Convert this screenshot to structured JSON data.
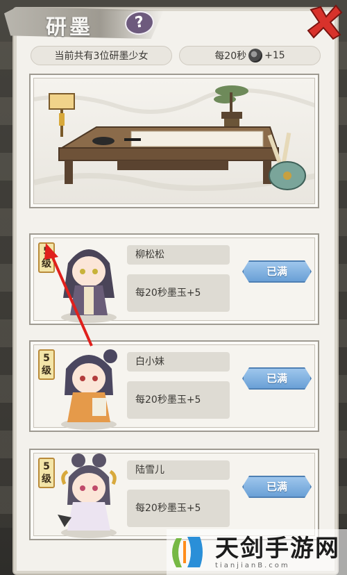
{
  "header": {
    "title": "研墨",
    "help_label": "?"
  },
  "info": {
    "count_text": "当前共有3位研墨少女",
    "rate_prefix": "每20秒",
    "rate_suffix": "+15"
  },
  "characters": [
    {
      "level_num": "5",
      "level_unit": "级",
      "name": "柳松松",
      "rate": "每20秒墨玉+5",
      "button": "已满"
    },
    {
      "level_num": "5",
      "level_unit": "级",
      "name": "白小妹",
      "rate": "每20秒墨玉+5",
      "button": "已满"
    },
    {
      "level_num": "5",
      "level_unit": "级",
      "name": "陆雪儿",
      "rate": "每20秒墨玉+5",
      "button": "已满"
    }
  ],
  "watermark": {
    "main": "天剑手游网",
    "sub": "tianjianB.com"
  },
  "colors": {
    "button_blue": "#6aa0d6",
    "close_red": "#d8322b",
    "help_purple": "#6d5a7d",
    "arrow_red": "#e0201c"
  }
}
